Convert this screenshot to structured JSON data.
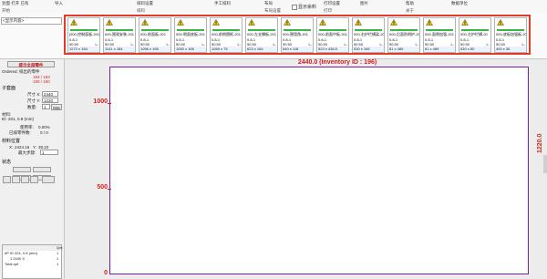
{
  "ribbon": {
    "groups": [
      {
        "label": "封面 打开 已有",
        "group_label": "开始"
      },
      {
        "label": "导入",
        "group_label": ""
      },
      {
        "label": "排料设置",
        "group_label": "排料"
      },
      {
        "label": "手工排料",
        "group_label": ""
      },
      {
        "label": "布局",
        "group_label": "布局设置"
      },
      {
        "label": "打印设置",
        "group_label": "打印"
      },
      {
        "label": "图片",
        "group_label": ""
      },
      {
        "label": "帮助",
        "group_label": "关于"
      },
      {
        "label": "数据单位",
        "group_label": ""
      }
    ],
    "checkbox_label": "显示余料"
  },
  "topstrip": {
    "dropdown_label": "<显示内容>"
  },
  "thumbnails": [
    {
      "title": "[000-控制面板-201",
      "l2": "0.8-1",
      "l3": "50.50",
      "l3r": "L-",
      "l4": "L-",
      "foot": "1272 x 184"
    },
    {
      "title": "000-围观安装-201",
      "l2": "0.8-1",
      "l3": "50.50",
      "l3r": "L-",
      "l4": "L-",
      "foot": "1141 x 184"
    },
    {
      "title": "000-前面板-201",
      "l2": "0.8-1",
      "l3": "50.50",
      "l3r": "L-",
      "l4": "L-",
      "foot": "1056 x 165"
    },
    {
      "title": "000-侧面底板-201",
      "l2": "0.8-1",
      "l3": "50.50",
      "l3r": "L-",
      "l4": "L-",
      "foot": "1050 x 166"
    },
    {
      "title": "000-前侧围框-201",
      "l2": "0.8-1",
      "l3": "50.50",
      "l3r": "L-",
      "l4": "L-",
      "foot": "1069 x 75"
    },
    {
      "title": "000-左支撑板-201",
      "l2": "0.8-1",
      "l3": "50.50",
      "l3r": "L-",
      "l4": "L-",
      "foot": "623 x 164"
    },
    {
      "title": "000-围墙角-201",
      "l2": "0.8-1",
      "l3": "50.50",
      "l3r": "L-",
      "l4": "L-",
      "foot": "540 x 118"
    },
    {
      "title": "000-前面中板-201",
      "l2": "0.8-1",
      "l3": "50.50",
      "l3r": "L-",
      "l4": "L-",
      "foot": "523 x 438.5"
    },
    {
      "title": "000-右护栏横梁-20",
      "l2": "0.8-1",
      "l3": "50.50",
      "l3r": "L-",
      "l4": "L-",
      "foot": "530 x 165"
    },
    {
      "title": "000-后面防侧护-20",
      "l2": "0.8-1",
      "l3": "50.50",
      "l3r": "L-",
      "l4": "L-",
      "foot": "81 x 489"
    },
    {
      "title": "000-面侧加强-201",
      "l2": "0.8-1",
      "l3": "50.50",
      "l3r": "L-",
      "l4": "L-",
      "foot": "81 x 489"
    },
    {
      "title": "000-左护栏横-20",
      "l2": "0.8-1",
      "l3": "50.50",
      "l3r": "L-",
      "l4": "L-",
      "foot": "530 x 80"
    },
    {
      "title": "000-底板加强板-20",
      "l2": "0.8-1",
      "l3": "50.50",
      "l3r": "L-",
      "l4": "L-",
      "foot": "400 x 36"
    }
  ],
  "left": {
    "title": "提示全部零件",
    "order_label": "Ordered: 排出的零件",
    "order_value": "193 / 193",
    "sub_value": "190 / 190",
    "plate_section": "子套面",
    "w_label": "尺寸 X:",
    "w_value": "2440",
    "h_label": "尺寸 Y:",
    "h_value": "1220",
    "qty_label": "数量:",
    "qty_value": "1",
    "apply_btn": "Mat",
    "material_label": "材料:",
    "material_value": "ID: 201, 0.8 (mm)",
    "usage_label": "使用率:",
    "usage_value": "0.00%",
    "placed_label": "已排零件数:",
    "placed_value": "0 / 0",
    "pos_section": "材料位置",
    "pos_x_label": "X:",
    "pos_x_value": "2424.16",
    "pos_y_label": "Y:",
    "pos_y_value": "39.22",
    "step_label": "最大步骤:",
    "step_value": "1",
    "status_section": "状态",
    "table_header_c2": "Qnt",
    "table_rows": [
      {
        "c1": "#P ID 201, 0.8 (mm)",
        "c2": "1"
      },
      {
        "c1": "1 2440 X",
        "c2": "1"
      },
      {
        "c1": "Total qnt",
        "c2": "1"
      }
    ]
  },
  "canvas": {
    "h_dim": "2440.0 (Inventory ID : 196)",
    "v_dim": "1220.0",
    "y_ticks": [
      "1000",
      "500",
      "0"
    ]
  }
}
